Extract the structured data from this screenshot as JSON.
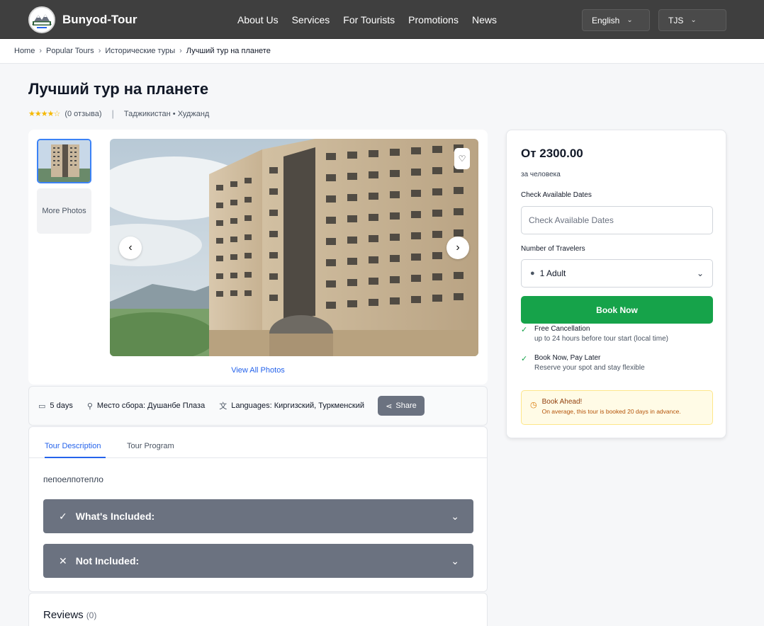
{
  "header": {
    "brand": "Bunyod-Tour",
    "nav": [
      "About Us",
      "Services",
      "For Tourists",
      "Promotions",
      "News"
    ],
    "language": "English",
    "currency": "TJS"
  },
  "breadcrumb": {
    "items": [
      "Home",
      "Popular Tours",
      "Исторические туры"
    ],
    "current": "Лучший тур на планете"
  },
  "tour": {
    "title": "Лучший тур на планете",
    "reviews_text": "(0 отзыва)",
    "location": "Таджикистан • Худжанд",
    "rating": 4.5
  },
  "gallery": {
    "more_photos": "More Photos",
    "view_all": "View All Photos"
  },
  "info": {
    "duration": "5 days",
    "meeting_point": "Место сбора: Душанбе Плаза",
    "languages": "Languages: Киргизский, Туркменский",
    "share": "Share"
  },
  "tabs": {
    "description": "Tour Description",
    "program": "Tour Program",
    "active": "Tour Description"
  },
  "description_text": "пепоелпотепло",
  "accordions": {
    "included": "What's Included:",
    "not_included": "Not Included:"
  },
  "reviews": {
    "title": "Reviews",
    "count": "(0)"
  },
  "booking": {
    "price": "От 2300.00",
    "per_person": "за человека",
    "dates_label": "Check Available Dates",
    "dates_placeholder": "Check Available Dates",
    "travelers_label": "Number of Travelers",
    "travelers_value": "1 Adult",
    "book_now": "Book Now",
    "perk1_title": "Free Cancellation",
    "perk1_text": "up to 24 hours before tour start (local time)",
    "perk2_title": "Book Now, Pay Later",
    "perk2_text": "Reserve your spot and stay flexible",
    "ahead_title": "Book Ahead!",
    "ahead_text": "On average, this tour is booked 20 days in advance."
  },
  "colors": {
    "header_bg": "#3f3f3f",
    "accent_blue": "#2563eb",
    "book_green": "#16a34a",
    "accordion_gray": "#6b7280"
  }
}
